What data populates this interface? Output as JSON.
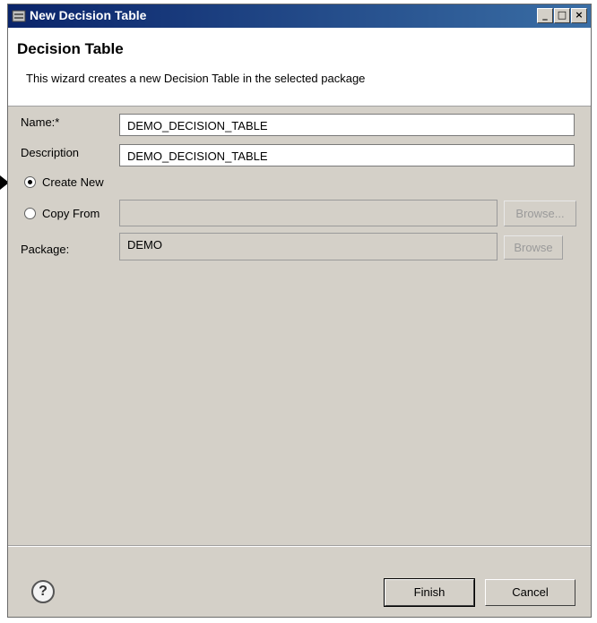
{
  "window": {
    "title": "New Decision Table",
    "controls": {
      "minimize": "_",
      "maximize": "□",
      "close": "×"
    }
  },
  "banner": {
    "heading": "Decision Table",
    "description": "This wizard creates a new Decision Table in the selected package"
  },
  "form": {
    "name_label": "Name:*",
    "name_value": "DEMO_DECISION_TABLE",
    "description_label": "Description",
    "description_value": "DEMO_DECISION_TABLE",
    "create_new_label": "Create New",
    "copy_from_label": "Copy From",
    "copy_from_value": "",
    "browse_label_1": "Browse...",
    "package_label": "Package:",
    "package_value": "DEMO",
    "browse_label_2": "Browse",
    "selected_option": "Create New"
  },
  "footer": {
    "help_glyph": "?",
    "finish_label": "Finish",
    "cancel_label": "Cancel"
  },
  "icons": [
    "app-icon",
    "minimize-icon",
    "maximize-icon",
    "close-icon",
    "help-icon",
    "pointer-arrow-icon"
  ]
}
